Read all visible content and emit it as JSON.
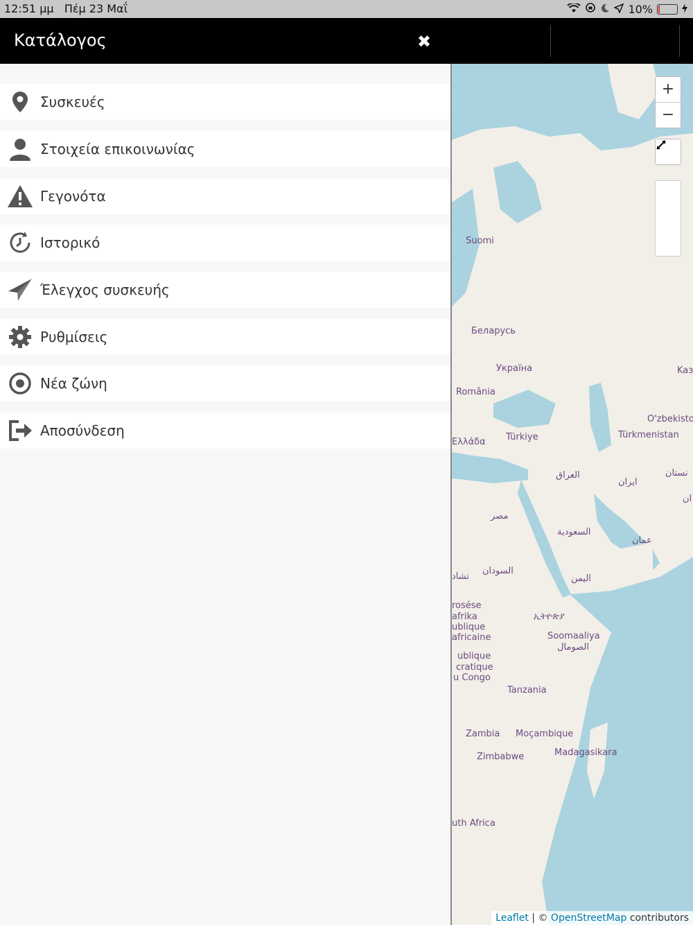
{
  "status_bar": {
    "time": "12:51 μμ",
    "date": "Πέμ 23 Μαΐ",
    "battery": "10%",
    "battery_level": 0.1
  },
  "header": {
    "title": "Κατάλογος",
    "close_glyph": "✖"
  },
  "menu": [
    {
      "label": "Συσκευές",
      "icon": "location-pin-icon"
    },
    {
      "label": "Στοιχεία επικοινωνίας",
      "icon": "person-icon"
    },
    {
      "label": "Γεγονότα",
      "icon": "warning-icon"
    },
    {
      "label": "Ιστορικό",
      "icon": "history-icon"
    },
    {
      "label": "Έλεγχος συσκευής",
      "icon": "paper-plane-icon"
    },
    {
      "label": "Ρυθμίσεις",
      "icon": "gear-icon"
    },
    {
      "label": "Νέα ζώνη",
      "icon": "target-icon"
    },
    {
      "label": "Αποσύνδεση",
      "icon": "logout-icon"
    }
  ],
  "map": {
    "zoom_in": "+",
    "zoom_out": "−",
    "labels": [
      "Suomi",
      "Беларусь",
      "Україна",
      "România",
      "Ελλάδα",
      "Türkiye",
      "Kaз",
      "O'zbekisto",
      "Türkmenistan",
      "العراق",
      "ایران",
      "نستان",
      "ان",
      "مصر",
      "السعودية",
      "عمان",
      "السودان",
      "اليمن",
      "تشاد",
      "rosése",
      "afrika",
      "ublique",
      "africaine",
      "ublique",
      "cratique",
      "u Congo",
      "ኢትዮጵያ",
      "Soomaaliya",
      "الصومال",
      "Tanzania",
      "Zambia",
      "Moçambique",
      "Zimbabwe",
      "Madagasikara",
      "uth Africa"
    ],
    "attribution": {
      "leaflet": "Leaflet",
      "sep": " | © ",
      "osm": "OpenStreetMap",
      "suffix": " contributors"
    }
  }
}
